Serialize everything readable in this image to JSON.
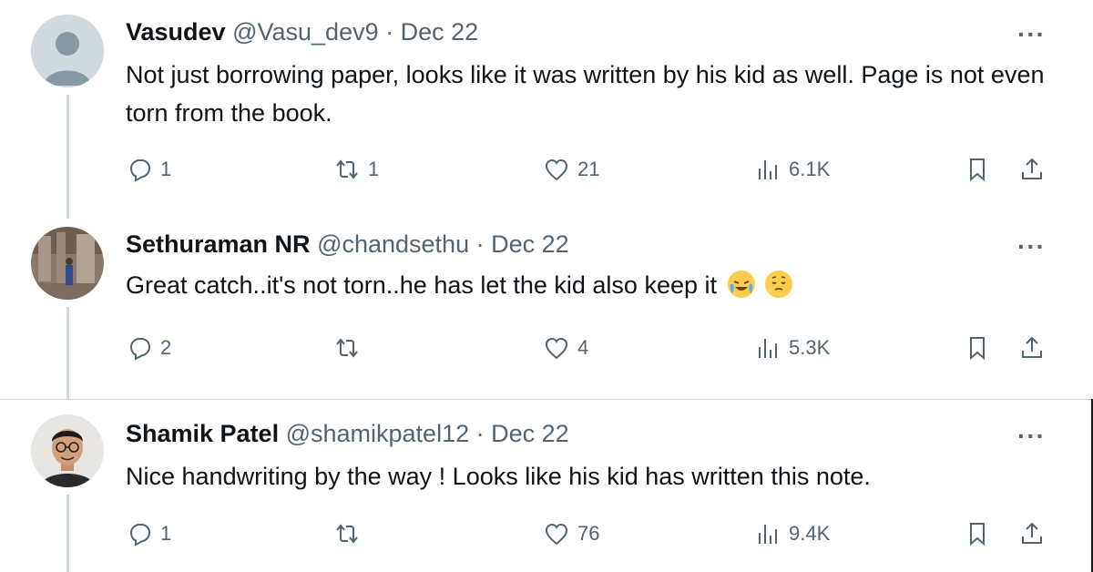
{
  "replies": [
    {
      "name": "Vasudev",
      "handle": "@Vasu_dev9",
      "date": "Dec 22",
      "text": "Not just borrowing paper, looks like it was written by his kid as well. Page is not even torn from the book.",
      "avatar_icon": "default-avatar-icon",
      "stats": {
        "replies": "1",
        "reposts": "1",
        "likes": "21",
        "views": "6.1K"
      }
    },
    {
      "name": "Sethuraman NR",
      "handle": "@chandsethu",
      "date": "Dec 22",
      "text": "Great catch..it's not torn..he has let the kid also keep it",
      "emojis": [
        "face-with-tears-of-joy-emoji",
        "relieved-face-emoji"
      ],
      "stats": {
        "replies": "2",
        "reposts": "",
        "likes": "4",
        "views": "5.3K"
      }
    },
    {
      "name": "Shamik Patel",
      "handle": "@shamikpatel12",
      "date": "Dec 22",
      "text": "Nice handwriting by the way ! Looks like his kid has written this note.",
      "stats": {
        "replies": "1",
        "reposts": "",
        "likes": "76",
        "views": "9.4K"
      }
    }
  ],
  "separator": "·",
  "more_label": "···",
  "colors": {
    "text": "#0f1419",
    "muted": "#536471",
    "thread_line": "#cfd9de"
  }
}
